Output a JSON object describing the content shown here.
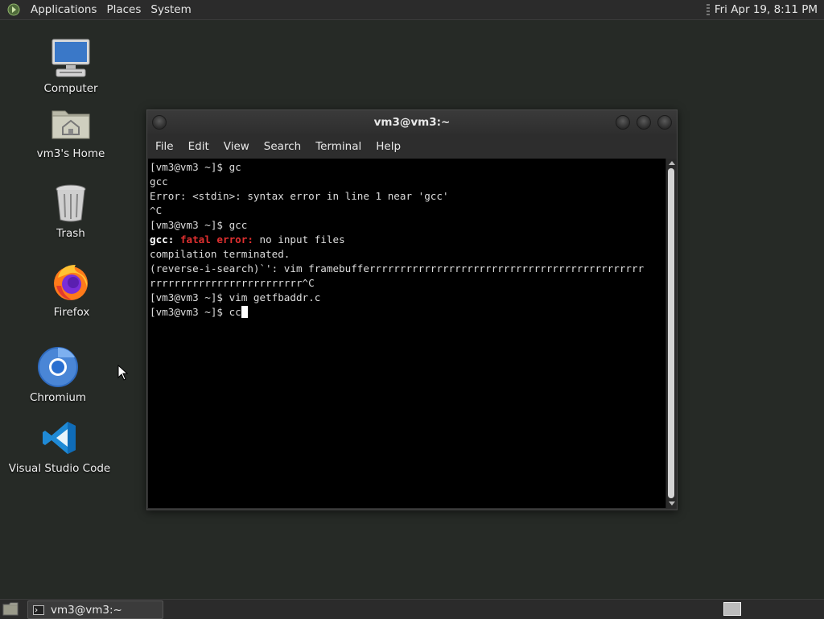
{
  "top_panel": {
    "menus": [
      "Applications",
      "Places",
      "System"
    ],
    "clock": "Fri Apr 19,  8:11 PM"
  },
  "desktop_icons": [
    {
      "label": "Computer",
      "icon": "computer-icon"
    },
    {
      "label": "vm3's Home",
      "icon": "home-folder-icon"
    },
    {
      "label": "Trash",
      "icon": "trash-icon"
    },
    {
      "label": "Firefox",
      "icon": "firefox-icon"
    },
    {
      "label": "Chromium",
      "icon": "chromium-icon"
    },
    {
      "label": "Visual Studio Code",
      "icon": "vscode-icon"
    }
  ],
  "terminal": {
    "title": "vm3@vm3:~",
    "menu": [
      "File",
      "Edit",
      "View",
      "Search",
      "Terminal",
      "Help"
    ],
    "lines": [
      "[vm3@vm3 ~]$ gc",
      "gcc",
      "Error: <stdin>: syntax error in line 1 near 'gcc'",
      "^C",
      "[vm3@vm3 ~]$ gcc",
      {
        "gcc_label": "gcc:",
        "fatal_label": "fatal error:",
        "message": " no input files"
      },
      "compilation terminated.",
      "(reverse-i-search)`': vim framebufferrrrrrrrrrrrrrrrrrrrrrrrrrrrrrrrrrrrrrrrrrrrr",
      "rrrrrrrrrrrrrrrrrrrrrrrrr^C",
      "[vm3@vm3 ~]$ vim getfbaddr.c",
      "[vm3@vm3 ~]$ cc"
    ]
  },
  "taskbar": {
    "task_label": "vm3@vm3:~"
  },
  "colors": {
    "desktop_bg": "#262a26",
    "terminal_bg": "#000000",
    "error_red": "#e03030"
  }
}
